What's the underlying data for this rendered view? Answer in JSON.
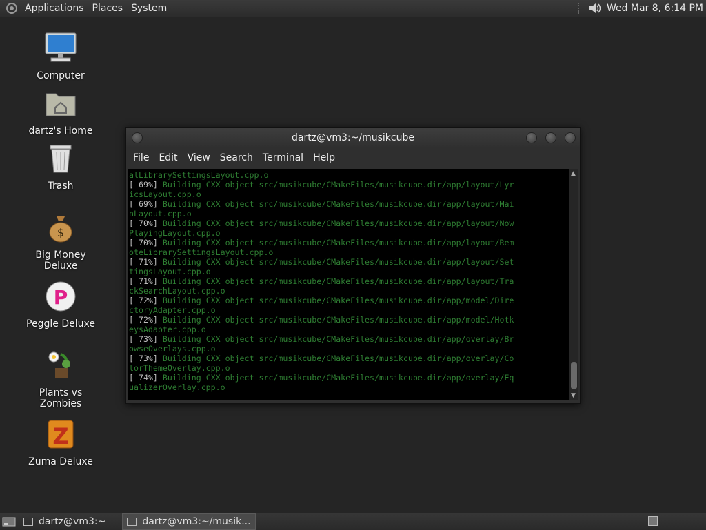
{
  "top_panel": {
    "menus": [
      "Applications",
      "Places",
      "System"
    ],
    "clock": "Wed Mar  8,  6:14 PM"
  },
  "desktop_icons": [
    {
      "label": "Computer",
      "icon": "computer-icon"
    },
    {
      "label": "dartz's Home",
      "icon": "home-folder-icon"
    },
    {
      "label": "Trash",
      "icon": "trash-icon"
    },
    {
      "label": "Big Money Deluxe",
      "icon": "money-bag-icon"
    },
    {
      "label": "Peggle Deluxe",
      "icon": "peggle-icon"
    },
    {
      "label": "Plants vs Zombies",
      "icon": "plants-vs-zombies-icon"
    },
    {
      "label": "Zuma Deluxe",
      "icon": "zuma-icon"
    }
  ],
  "terminal": {
    "title": "dartz@vm3:~/musikcube",
    "menus": [
      "File",
      "Edit",
      "View",
      "Search",
      "Terminal",
      "Help"
    ],
    "lines": [
      "alLibrarySettingsLayout.cpp.o",
      "[ 69%] Building CXX object src/musikcube/CMakeFiles/musikcube.dir/app/layout/Lyr",
      "icsLayout.cpp.o",
      "[ 69%] Building CXX object src/musikcube/CMakeFiles/musikcube.dir/app/layout/Mai",
      "nLayout.cpp.o",
      "[ 70%] Building CXX object src/musikcube/CMakeFiles/musikcube.dir/app/layout/Now",
      "PlayingLayout.cpp.o",
      "[ 70%] Building CXX object src/musikcube/CMakeFiles/musikcube.dir/app/layout/Rem",
      "oteLibrarySettingsLayout.cpp.o",
      "[ 71%] Building CXX object src/musikcube/CMakeFiles/musikcube.dir/app/layout/Set",
      "tingsLayout.cpp.o",
      "[ 71%] Building CXX object src/musikcube/CMakeFiles/musikcube.dir/app/layout/Tra",
      "ckSearchLayout.cpp.o",
      "[ 72%] Building CXX object src/musikcube/CMakeFiles/musikcube.dir/app/model/Dire",
      "ctoryAdapter.cpp.o",
      "[ 72%] Building CXX object src/musikcube/CMakeFiles/musikcube.dir/app/model/Hotk",
      "eysAdapter.cpp.o",
      "[ 73%] Building CXX object src/musikcube/CMakeFiles/musikcube.dir/app/overlay/Br",
      "owseOverlays.cpp.o",
      "[ 73%] Building CXX object src/musikcube/CMakeFiles/musikcube.dir/app/overlay/Co",
      "lorThemeOverlay.cpp.o",
      "[ 74%] Building CXX object src/musikcube/CMakeFiles/musikcube.dir/app/overlay/Eq",
      "ualizerOverlay.cpp.o"
    ]
  },
  "taskbar": {
    "tasks": [
      {
        "label": "dartz@vm3:~",
        "active": false
      },
      {
        "label": "dartz@vm3:~/musik...",
        "active": true
      }
    ]
  }
}
